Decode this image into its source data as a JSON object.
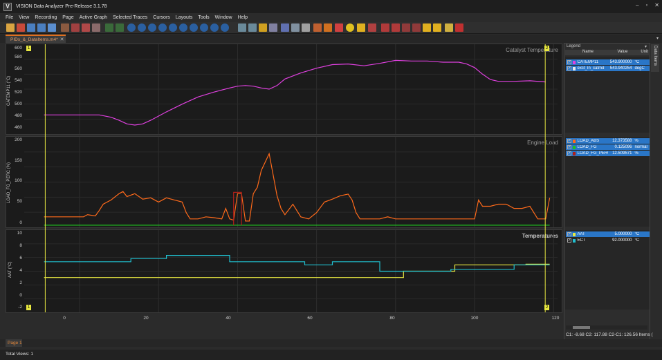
{
  "app": {
    "title": "VISION Data Analyzer Pre-Release 3.1.78",
    "logo_text": "V"
  },
  "window_controls": {
    "minimize": "–",
    "restore": "▫",
    "close": "✕"
  },
  "menu": [
    "File",
    "View",
    "Recording",
    "Page",
    "Active Graph",
    "Selected Traces",
    "Cursors",
    "Layouts",
    "Tools",
    "Window",
    "Help"
  ],
  "doc_tab": {
    "label": "PIDs_&_DataItems.m4*",
    "close": "✕"
  },
  "panes": [
    {
      "title": "Catalyst Temperature",
      "ylabel": "CATEMP11 (°C)",
      "yticks": [
        "600",
        "580",
        "560",
        "540",
        "520",
        "500",
        "480",
        "460"
      ]
    },
    {
      "title": "Engine Load",
      "ylabel": "LOAD_FG_PERC (%)",
      "yticks": [
        "200",
        "150",
        "100",
        "50",
        "0"
      ]
    },
    {
      "title": "Temperatures",
      "ylabel": "AAT (°C)",
      "yticks": [
        "10",
        "8",
        "6",
        "4",
        "2",
        "0",
        "-2"
      ]
    }
  ],
  "x_axis": {
    "ticks": [
      "0",
      "20",
      "40",
      "60",
      "80",
      "100",
      "120"
    ]
  },
  "cursors": {
    "c1_label": "1",
    "c2_label": "2",
    "c1_x": -8.68,
    "c2_x": 117.88
  },
  "chart_data": [
    {
      "type": "line",
      "title": "Catalyst Temperature",
      "ylabel": "CATEMP11 (°C)",
      "ylim": [
        455,
        605
      ],
      "xlim": [
        -14,
        121
      ],
      "series": [
        {
          "name": "CATEMP11",
          "color": "#e040e0",
          "x": [
            -9,
            5,
            8,
            10,
            12,
            14,
            16,
            18,
            22,
            26,
            30,
            34,
            38,
            40,
            42,
            44,
            46,
            48,
            50,
            52,
            56,
            60,
            64,
            68,
            72,
            76,
            80,
            84,
            88,
            92,
            96,
            98,
            100,
            102,
            104,
            106,
            110,
            114,
            118
          ],
          "y": [
            487,
            487,
            483,
            478,
            472,
            470,
            472,
            478,
            492,
            505,
            517,
            525,
            532,
            535,
            536,
            535,
            532,
            530,
            536,
            547,
            557,
            565,
            571,
            572,
            569,
            573,
            578,
            577,
            577,
            575,
            575,
            572,
            566,
            555,
            546,
            543,
            543,
            544,
            542
          ]
        },
        {
          "name": "exct_In_catmd",
          "color": "#e8e8e8",
          "x": [],
          "y": []
        }
      ]
    },
    {
      "type": "line",
      "title": "Engine Load",
      "ylabel": "LOAD_FG_PERC (%)",
      "ylim": [
        -5,
        210
      ],
      "xlim": [
        -14,
        121
      ],
      "series": [
        {
          "name": "LOAD_ABS",
          "color": "#ff6a1a",
          "x": [
            -9,
            1,
            2,
            4,
            5,
            6,
            8,
            10,
            11,
            12,
            14,
            16,
            18,
            20,
            22,
            24,
            26,
            27,
            28,
            30,
            32,
            34,
            36,
            37,
            38,
            39,
            40,
            41,
            42,
            43,
            44,
            45,
            46,
            47,
            48,
            49,
            50,
            51,
            52,
            54,
            56,
            58,
            60,
            62,
            64,
            66,
            68,
            69,
            70,
            71,
            72,
            74,
            76,
            78,
            80,
            82,
            84,
            86,
            88,
            90,
            92,
            94,
            96,
            98,
            99,
            100,
            101,
            102,
            104,
            106,
            108,
            110,
            112,
            114,
            116,
            118,
            119
          ],
          "y": [
            20,
            20,
            25,
            22,
            35,
            50,
            60,
            75,
            80,
            68,
            75,
            62,
            65,
            55,
            65,
            60,
            55,
            30,
            15,
            15,
            20,
            18,
            15,
            40,
            15,
            12,
            75,
            75,
            10,
            10,
            75,
            90,
            130,
            150,
            170,
            120,
            70,
            40,
            25,
            50,
            20,
            15,
            30,
            55,
            62,
            70,
            74,
            60,
            30,
            15,
            15,
            15,
            15,
            20,
            15,
            15,
            15,
            15,
            15,
            15,
            15,
            15,
            15,
            15,
            15,
            15,
            60,
            45,
            45,
            50,
            50,
            40,
            40,
            45,
            15,
            15,
            65
          ]
        },
        {
          "name": "LOAD_FG",
          "color": "#20c020",
          "x": [
            -9,
            119
          ],
          "y": [
            0.1,
            0.1
          ]
        },
        {
          "name": "LOAD_FG_PERC",
          "color": "#b0201a",
          "x": [
            39,
            39,
            41,
            41
          ],
          "y": [
            0,
            78,
            78,
            0
          ]
        }
      ]
    },
    {
      "type": "line",
      "title": "Temperatures",
      "ylabel": "AAT (°C)",
      "ylim": [
        -2.5,
        10.5
      ],
      "xlim": [
        -14,
        121
      ],
      "series": [
        {
          "name": "AAT",
          "color": "#e8e840",
          "x": [
            -9,
            82,
            82,
            95,
            95,
            113,
            113,
            119
          ],
          "y": [
            3,
            3,
            4,
            4,
            5,
            5,
            5.1,
            5.1
          ]
        },
        {
          "name": "ECT",
          "color": "#20c0d0",
          "x": [
            -9,
            13,
            13,
            22,
            22,
            38,
            38,
            57,
            57,
            64,
            64,
            76,
            76,
            94,
            94,
            110,
            110,
            119
          ],
          "y": [
            5.5,
            5.5,
            6,
            6,
            6.5,
            6.5,
            5.5,
            5.5,
            5,
            5,
            5.5,
            5.5,
            4,
            4,
            4.3,
            4.3,
            5,
            5
          ]
        }
      ]
    }
  ],
  "legend": {
    "header": "Legend",
    "col_name": "Name",
    "col_value": "Value",
    "col_unit": "Unit",
    "groups": [
      [
        {
          "name": "CATEMP11",
          "value": "543.900000",
          "unit": "°C",
          "color": "#e040e0",
          "selected": true
        },
        {
          "name": "exct_In_catmd",
          "value": "543.940254",
          "unit": "degC",
          "color": "#e8e8e8",
          "selected": true
        }
      ],
      [
        {
          "name": "LOAD_ABS",
          "value": "12.373588",
          "unit": "%",
          "color": "#ff6a1a",
          "selected": true
        },
        {
          "name": "LOAD_FG",
          "value": "0.125096",
          "unit": "normal",
          "color": "#20c020",
          "selected": true
        },
        {
          "name": "LOAD_FG_PERC",
          "value": "12.509571",
          "unit": "%",
          "color": "#b0201a",
          "selected": true
        }
      ],
      [
        {
          "name": "AAT",
          "value": "5.000000",
          "unit": "°C",
          "color": "#e8e840",
          "selected": true
        },
        {
          "name": "ECT",
          "value": "92.000000",
          "unit": "°C",
          "color": "#20c0d0",
          "selected": false
        }
      ]
    ]
  },
  "side_tab": "Data Items",
  "cursor_readout": "C1: -8.68   C2: 117.88   C2-C1: 126.56   Items (",
  "page_tab": "Page 1",
  "status": "Total Views: 1"
}
